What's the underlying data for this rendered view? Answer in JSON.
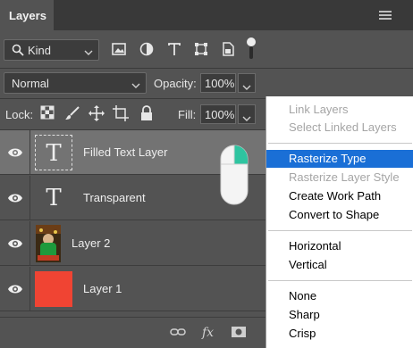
{
  "header": {
    "tab_label": "Layers"
  },
  "filter": {
    "kind_label": "Kind"
  },
  "blend": {
    "mode": "Normal",
    "opacity_label": "Opacity:",
    "opacity_value": "100%"
  },
  "lock": {
    "label": "Lock:",
    "fill_label": "Fill:",
    "fill_value": "100%"
  },
  "layers": [
    {
      "name": "Filled Text Layer",
      "thumb": "T",
      "selected": true
    },
    {
      "name": "Transparent",
      "thumb": "T",
      "selected": false
    },
    {
      "name": "Layer 2",
      "thumb": "image",
      "selected": false
    },
    {
      "name": "Layer 1",
      "thumb": "red",
      "selected": false
    }
  ],
  "colors": {
    "layer1_fill": "#f04433",
    "menu_highlight": "#1a6fd6",
    "mouse_button": "#2ec4a0"
  },
  "menu": {
    "items": [
      {
        "label": "Link Layers",
        "enabled": false
      },
      {
        "label": "Select Linked Layers",
        "enabled": false
      },
      {
        "label": "Rasterize Type",
        "enabled": true,
        "highlighted": true
      },
      {
        "label": "Rasterize Layer Style",
        "enabled": false
      },
      {
        "label": "Create Work Path",
        "enabled": true
      },
      {
        "label": "Convert to Shape",
        "enabled": true
      },
      {
        "label": "Horizontal",
        "enabled": true
      },
      {
        "label": "Vertical",
        "enabled": true
      },
      {
        "label": "None",
        "enabled": true
      },
      {
        "label": "Sharp",
        "enabled": true
      },
      {
        "label": "Crisp",
        "enabled": true
      }
    ]
  },
  "bottom_bar": {
    "fx_label": "fx"
  }
}
